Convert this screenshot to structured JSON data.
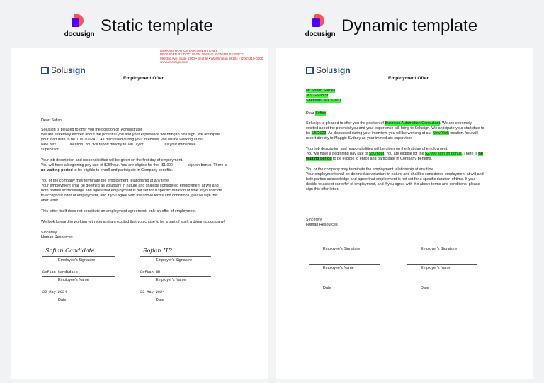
{
  "headers": {
    "static_logo": "docusign",
    "static_title": "Static template",
    "dynamic_logo": "docusign",
    "dynamic_title": "Dynamic template"
  },
  "static_doc": {
    "demo_notice": [
      "DEMONSTRATION DOCUMENT ONLY",
      "PROVIDED BY DOCUSIGN ONLINE SIGNING SERVICE",
      "999 3rd Ave, Suite 1700 • Seattle • Washington 98104 • (206) 219-0200",
      "www.docusign.com"
    ],
    "brand_pre": "Solu",
    "brand_bold": "sign",
    "title": "Employment Offer",
    "dear": "Dear",
    "name": "Sofian",
    "l1a": "Solusign is pleased to offer you the position of",
    "position": "Administrator",
    "l2": "We are extremely excited about the potential you and your experience will bring to Solusign. We anticipate",
    "l3a": "your start date to be",
    "date": "01/01/2024",
    "l3b": ". As discussed during your interview, you will be working at our",
    "location": "New York",
    "l4b": "location. You will report directly to",
    "manager": "Jon Taylor",
    "l4c": "as your immediate",
    "l5": "supervisor.",
    "p2a": "Your job description and responsibilities will be given on the first day of employment.",
    "p2b1": "You will have a beginning pay rate of $",
    "rate": "25",
    "p2b2": "/hour. You are eligible for the",
    "bonus": "$1,000",
    "p2b3": "sign on bonus. There is",
    "p2c1": "no waiting period",
    "p2c2": " to be eligible to enroll and participate in Company benefits.",
    "p3a": "You or the company may terminate the employment relationship at any time.",
    "p3b": "Your employment shall be deemed as voluntary in nature and shall be considered employment at will and",
    "p3c": "both parties acknowledge and agree that employment is not set for a specific duration of time. If you decide",
    "p3d": "to accept our offer of employment, and if you agree with the above terms and conditions, please sign this",
    "p3e": "offer letter.",
    "p4": "This letter itself does not constitute an employment agreement, only an offer of employment.",
    "p5": "We look forward to working with you and am excited that you chose to be a part of such a dynamic company!",
    "sincerely": "Sincerely,",
    "hr": "Human Resources",
    "emp_sig_image": "Sofian Candidate",
    "employer_sig_image": "Sofian HR",
    "emp_sig_label": "Employee's Signature",
    "employer_sig_label": "Employer's Signature",
    "emp_name_value": "Sofian Candidate",
    "employer_name_value": "Sofian HR",
    "emp_name_label": "Employee's Name",
    "employer_name_label": "Employer's Name",
    "emp_date_value": "22 May 2024",
    "employer_date_value": "22 May 2024",
    "date_label": "Date"
  },
  "dynamic_doc": {
    "brand_pre": "Solu",
    "brand_bold": "sign",
    "title": "Employment Offer",
    "addr1": "Mr Sofian Sarcell",
    "addr2": "309 Gould St",
    "addr3": "Sheridan, WY 82801",
    "dear": "Dear",
    "name": "Sofian",
    "l1a": "Solusign is pleased to offer you the position of",
    "position": "Business Automation Consultant",
    "l1b": ". We are extremely",
    "l2": "excited about the potential you and your experience will bring to Solusign. We anticipate your start date to",
    "l3a": "be",
    "date": "5/5/2023",
    "l3b": ". As discussed during your interview, you will be working at our",
    "location": "New York",
    "l3c": "location. You will",
    "l4": "report directly to Maggie Sydney as your immediate supervisor.",
    "p2a": "Your job description and responsibilities will be given on the first day of employment.",
    "p2b1": "You will have a beginning pay rate of",
    "rate": "$50/hour",
    "p2b2": ". You are eligible for the",
    "bonus": "$2,000 sign on bonus",
    "p2b3": ". There is",
    "p2b4": "no",
    "p2c1": "waiting period",
    "p2c2": " to be eligible to enroll and participate in Company benefits.",
    "p3a": "You or the company may terminate the employment relationship at any time.",
    "p3b": "Your employment shall be deemed as voluntary in nature and shall be considered employment at will and",
    "p3c": "both parties acknowledge and agree that employment is not set for a specific duration of time. If you",
    "p3d": "decide to accept our offer of employment, and if you agree with the above terms and conditions, please",
    "p3e": "sign this offer letter.",
    "sincerely": "Sincerely,",
    "hr": "Human Resources",
    "emp_sig_label": "Employee's Signature",
    "employer_sig_label": "Employer's Signature",
    "emp_name_label": "Employee's Name",
    "employer_name_label": "Employer's Name",
    "date_label": "Date"
  },
  "colors": {
    "highlight": "#3ef23e",
    "brand_blue": "#1f4e9a",
    "notice_red": "#d22222"
  }
}
